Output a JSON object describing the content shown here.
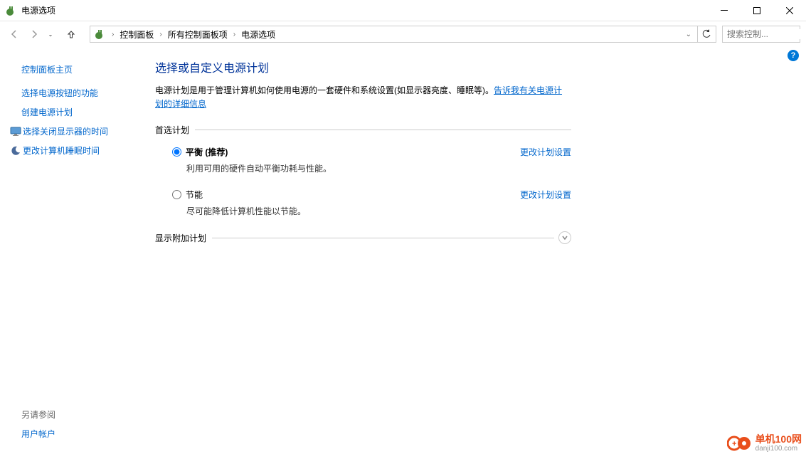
{
  "window": {
    "title": "电源选项"
  },
  "breadcrumb": {
    "items": [
      "控制面板",
      "所有控制面板项",
      "电源选项"
    ]
  },
  "search": {
    "placeholder": "搜索控制..."
  },
  "sidebar": {
    "home": "控制面板主页",
    "items": [
      {
        "label": "选择电源按钮的功能",
        "icon": null
      },
      {
        "label": "创建电源计划",
        "icon": null
      },
      {
        "label": "选择关闭显示器的时间",
        "icon": "monitor"
      },
      {
        "label": "更改计算机睡眠时间",
        "icon": "moon"
      }
    ],
    "see_also_label": "另请参阅",
    "see_also_items": [
      "用户帐户"
    ]
  },
  "main": {
    "title": "选择或自定义电源计划",
    "desc_prefix": "电源计划是用于管理计算机如何使用电源的一套硬件和系统设置(如显示器亮度、睡眠等)。",
    "desc_link": "告诉我有关电源计划的详细信息",
    "section_preferred": "首选计划",
    "section_additional": "显示附加计划",
    "change_settings": "更改计划设置",
    "plans": [
      {
        "name": "平衡 (推荐)",
        "desc": "利用可用的硬件自动平衡功耗与性能。",
        "selected": true
      },
      {
        "name": "节能",
        "desc": "尽可能降低计算机性能以节能。",
        "selected": false
      }
    ]
  },
  "watermark": {
    "cn": "单机100网",
    "en": "danji100.com"
  }
}
